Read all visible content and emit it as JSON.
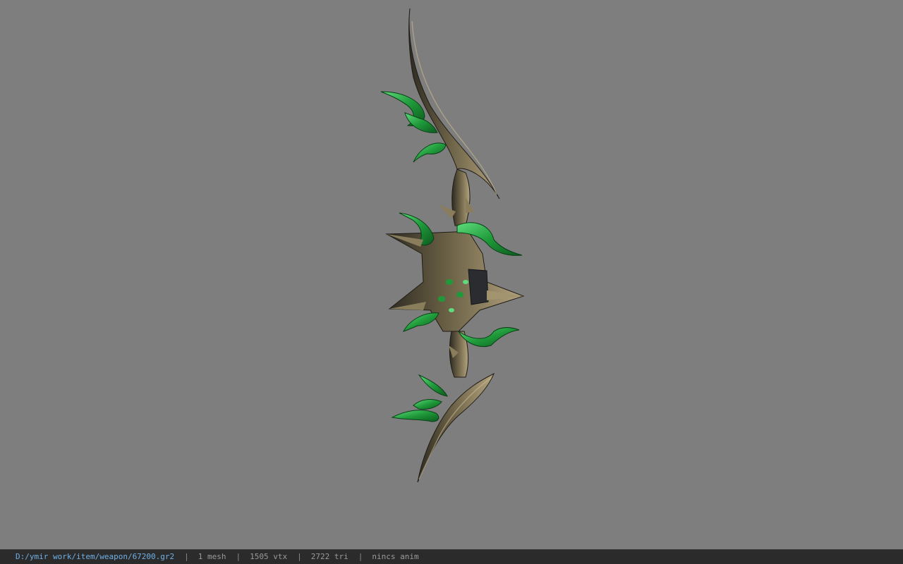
{
  "viewport": {
    "background_color": "#7e7e7e",
    "model_icon": "elven-bow-3d-model",
    "colors": {
      "wood_dark": "#2e2a22",
      "wood_mid": "#6b6146",
      "wood_light": "#b4a47e",
      "gem_dark": "#0c5a1e",
      "gem_mid": "#1f9a3a",
      "gem_light": "#5fdc7c",
      "core_dark": "#2a2c30"
    }
  },
  "status_bar": {
    "file_path": "D:/ymir work/item/weapon/67200.gr2",
    "separator": "|",
    "mesh_count": "1 mesh",
    "vertex_count": "1505 vtx",
    "triangle_count": "2722 tri",
    "animation": "nincs anim",
    "colors": {
      "background": "#2b2b2b",
      "path": "#6fb0e6",
      "text": "#9a9a9a"
    }
  }
}
